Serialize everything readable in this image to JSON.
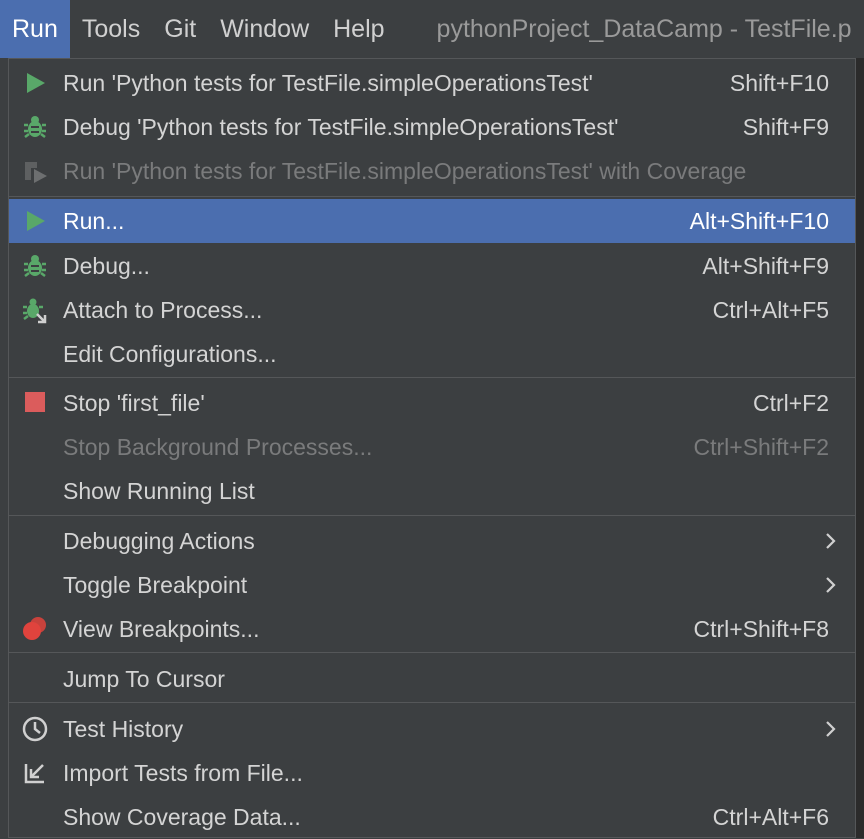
{
  "menubar": {
    "items": [
      "Run",
      "Tools",
      "Git",
      "Window",
      "Help"
    ],
    "title": "pythonProject_DataCamp - TestFile.p"
  },
  "menu": {
    "items": [
      {
        "label": "Run 'Python tests for TestFile.simpleOperationsTest'",
        "shortcut": "Shift+F10",
        "icon": "play-icon"
      },
      {
        "label": "Debug 'Python tests for TestFile.simpleOperationsTest'",
        "shortcut": "Shift+F9",
        "icon": "bug-icon"
      },
      {
        "label": "Run 'Python tests for TestFile.simpleOperationsTest' with Coverage",
        "shortcut": "",
        "icon": "coverage-icon",
        "disabled": true
      },
      {
        "label": "Run...",
        "shortcut": "Alt+Shift+F10",
        "icon": "play-icon",
        "selected": true
      },
      {
        "label": "Debug...",
        "shortcut": "Alt+Shift+F9",
        "icon": "bug-icon"
      },
      {
        "label": "Attach to Process...",
        "shortcut": "Ctrl+Alt+F5",
        "icon": "attach-bug-icon"
      },
      {
        "label": "Edit Configurations...",
        "shortcut": ""
      },
      {
        "label": "Stop 'first_file'",
        "shortcut": "Ctrl+F2",
        "icon": "stop-icon"
      },
      {
        "label": "Stop Background Processes...",
        "shortcut": "Ctrl+Shift+F2",
        "disabled": true
      },
      {
        "label": "Show Running List",
        "shortcut": ""
      },
      {
        "label": "Debugging Actions",
        "shortcut": "",
        "submenu": true
      },
      {
        "label": "Toggle Breakpoint",
        "shortcut": "",
        "submenu": true
      },
      {
        "label": "View Breakpoints...",
        "shortcut": "Ctrl+Shift+F8",
        "icon": "breakpoints-icon"
      },
      {
        "label": "Jump To Cursor",
        "shortcut": ""
      },
      {
        "label": "Test History",
        "shortcut": "",
        "icon": "clock-icon",
        "submenu": true
      },
      {
        "label": "Import Tests from File...",
        "shortcut": "",
        "icon": "import-icon"
      },
      {
        "label": "Show Coverage Data...",
        "shortcut": "Ctrl+Alt+F6"
      }
    ]
  },
  "colors": {
    "accent": "#4b6eaf",
    "play": "#59a869",
    "stop": "#db5c5c",
    "breakpoint": "#e0433d"
  }
}
